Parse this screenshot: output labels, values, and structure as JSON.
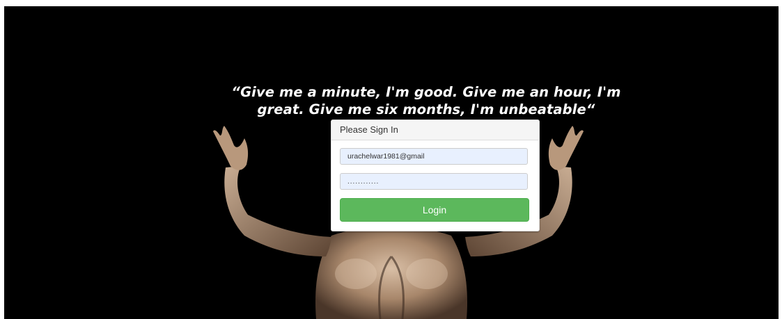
{
  "hero": {
    "quote": "“Give me a minute, I'm good. Give me an hour, I'm great. Give me six months, I'm unbeatable“"
  },
  "login": {
    "heading": "Please Sign In",
    "email_value": "urachelwar1981@gmail",
    "password_value": "............",
    "button_label": "Login"
  },
  "colors": {
    "background": "#000000",
    "button": "#5cb85c",
    "input_fill": "#e8f0fe"
  }
}
